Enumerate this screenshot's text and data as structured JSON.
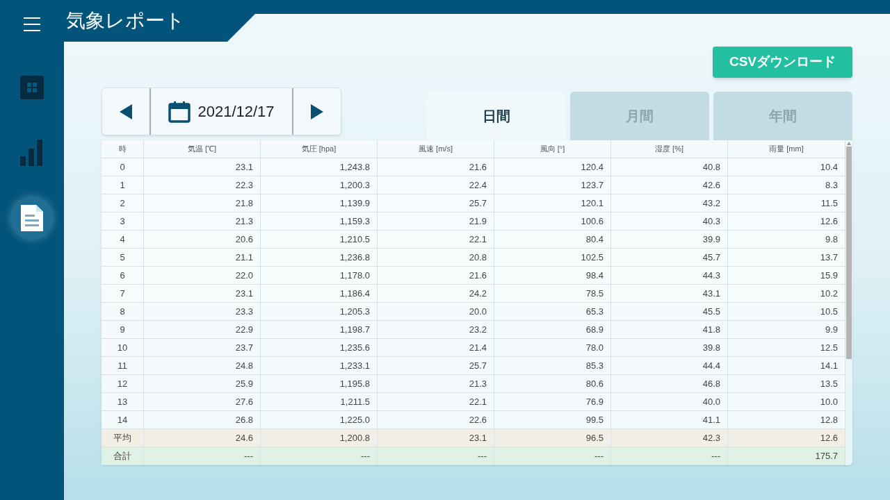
{
  "app": {
    "title": "気象レポート"
  },
  "sidebar": {
    "items": [
      {
        "kind": "dashboard",
        "selected": false
      },
      {
        "kind": "chart",
        "selected": false
      },
      {
        "kind": "report",
        "selected": true
      }
    ]
  },
  "toolbar": {
    "export_button": "CSVダウンロード",
    "date": "2021/12/17"
  },
  "tabs": [
    {
      "label": "日間",
      "selected": true
    },
    {
      "label": "月間",
      "selected": false
    },
    {
      "label": "年間",
      "selected": false
    }
  ],
  "table": {
    "columns": [
      "時",
      "気温 [℃]",
      "気圧 [hpa]",
      "風速 [m/s]",
      "風向 [°]",
      "湿度 [%]",
      "雨量 [mm]"
    ],
    "rows": [
      {
        "kind": "data",
        "cells": [
          "0",
          "23.1",
          "1,243.8",
          "21.6",
          "120.4",
          "40.8",
          "10.4"
        ]
      },
      {
        "kind": "data",
        "cells": [
          "1",
          "22.3",
          "1,200.3",
          "22.4",
          "123.7",
          "42.6",
          "8.3"
        ]
      },
      {
        "kind": "data",
        "cells": [
          "2",
          "21.8",
          "1,139.9",
          "25.7",
          "120.1",
          "43.2",
          "11.5"
        ]
      },
      {
        "kind": "data",
        "cells": [
          "3",
          "21.3",
          "1,159.3",
          "21.9",
          "100.6",
          "40.3",
          "12.6"
        ]
      },
      {
        "kind": "data",
        "cells": [
          "4",
          "20.6",
          "1,210.5",
          "22.1",
          "80.4",
          "39.9",
          "9.8"
        ]
      },
      {
        "kind": "data",
        "cells": [
          "5",
          "21.1",
          "1,236.8",
          "20.8",
          "102.5",
          "45.7",
          "13.7"
        ]
      },
      {
        "kind": "data",
        "cells": [
          "6",
          "22.0",
          "1,178.0",
          "21.6",
          "98.4",
          "44.3",
          "15.9"
        ]
      },
      {
        "kind": "data",
        "cells": [
          "7",
          "23.1",
          "1,186.4",
          "24.2",
          "78.5",
          "43.1",
          "10.2"
        ]
      },
      {
        "kind": "data",
        "cells": [
          "8",
          "23.3",
          "1,205.3",
          "20.0",
          "65.3",
          "45.5",
          "10.5"
        ]
      },
      {
        "kind": "data",
        "cells": [
          "9",
          "22.9",
          "1,198.7",
          "23.2",
          "68.9",
          "41.8",
          "9.9"
        ]
      },
      {
        "kind": "data",
        "cells": [
          "10",
          "23.7",
          "1,235.6",
          "21.4",
          "78.0",
          "39.8",
          "12.5"
        ]
      },
      {
        "kind": "data",
        "cells": [
          "11",
          "24.8",
          "1,233.1",
          "25.7",
          "85.3",
          "44.4",
          "14.1"
        ]
      },
      {
        "kind": "data",
        "cells": [
          "12",
          "25.9",
          "1,195.8",
          "21.3",
          "80.6",
          "46.8",
          "13.5"
        ]
      },
      {
        "kind": "data",
        "cells": [
          "13",
          "27.6",
          "1,211.5",
          "22.1",
          "76.9",
          "40.0",
          "10.0"
        ]
      },
      {
        "kind": "data",
        "cells": [
          "14",
          "26.8",
          "1,225.0",
          "22.6",
          "99.5",
          "41.1",
          "12.8"
        ]
      },
      {
        "kind": "average",
        "cells": [
          "平均",
          "24.6",
          "1,200.8",
          "23.1",
          "96.5",
          "42.3",
          "12.6"
        ]
      },
      {
        "kind": "total",
        "cells": [
          "合計",
          "---",
          "---",
          "---",
          "---",
          "---",
          "175.7"
        ]
      }
    ]
  }
}
